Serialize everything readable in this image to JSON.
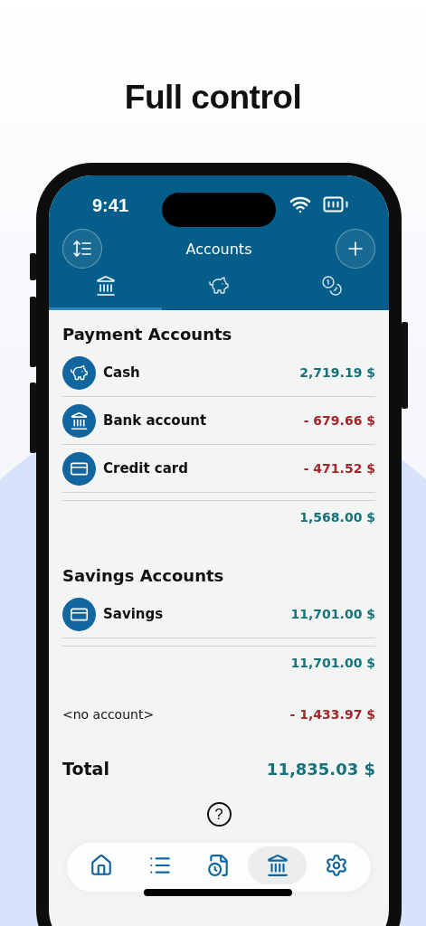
{
  "headline": "Full control",
  "status_bar": {
    "time": "9:41"
  },
  "header": {
    "title": "Accounts"
  },
  "tabs": [
    {
      "kind": "bank",
      "selected": true
    },
    {
      "kind": "piggy",
      "selected": false
    },
    {
      "kind": "coins",
      "selected": false
    }
  ],
  "sections": [
    {
      "title": "Payment Accounts",
      "accounts": [
        {
          "kind": "cash",
          "name": "Cash",
          "amount": "2,719.19 $",
          "negative": false
        },
        {
          "kind": "bank",
          "name": "Bank account",
          "amount": "- 679.66 $",
          "negative": true
        },
        {
          "kind": "card",
          "name": "Credit card",
          "amount": "- 471.52 $",
          "negative": true
        }
      ],
      "subtotal": {
        "amount": "1,568.00 $",
        "negative": false
      }
    },
    {
      "title": "Savings Accounts",
      "accounts": [
        {
          "kind": "card",
          "name": "Savings",
          "amount": "11,701.00 $",
          "negative": false
        }
      ],
      "subtotal": {
        "amount": "11,701.00 $",
        "negative": false
      }
    }
  ],
  "no_account": {
    "label": "<no account>",
    "amount": "- 1,433.97 $",
    "negative": true
  },
  "total": {
    "label": "Total",
    "amount": "11,835.03 $",
    "negative": false
  },
  "help": {
    "symbol": "?"
  },
  "bottom_nav": [
    {
      "kind": "home",
      "selected": false
    },
    {
      "kind": "list",
      "selected": false
    },
    {
      "kind": "schedule",
      "selected": false
    },
    {
      "kind": "accounts",
      "selected": true
    },
    {
      "kind": "settings",
      "selected": false
    }
  ]
}
